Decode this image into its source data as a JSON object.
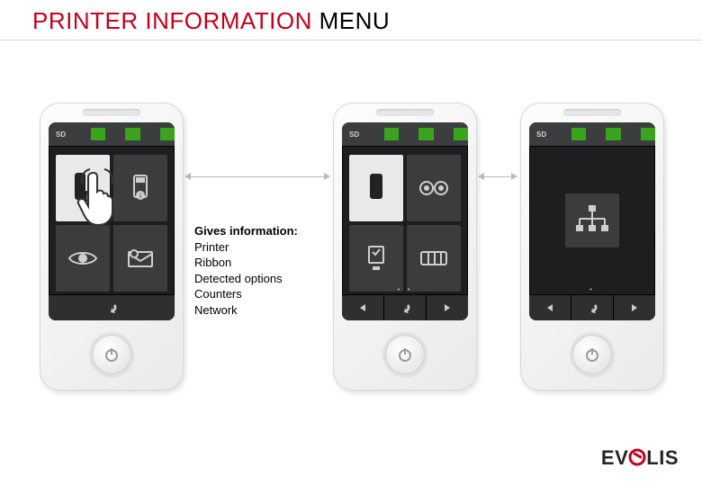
{
  "title": {
    "red": "PRINTER INFORMATION ",
    "black": "MENU"
  },
  "info": {
    "heading": "Gives information:",
    "items": [
      "Printer",
      "Ribbon",
      "Detected options",
      "Counters",
      "Network"
    ]
  },
  "statusbar_label": "SD",
  "devices": {
    "d1": {
      "tiles": [
        "printer-info-icon",
        "card-info-icon",
        "view-icon",
        "mail-icon"
      ],
      "selected_index": 0,
      "nav": [
        "back"
      ],
      "dots": ""
    },
    "d2": {
      "tiles": [
        "printer-icon",
        "ribbon-icon",
        "options-icon",
        "counters-icon"
      ],
      "selected_index": 0,
      "nav": [
        "prev",
        "back",
        "next"
      ],
      "dots": "• •"
    },
    "d3": {
      "single_tile": "network-icon",
      "nav": [
        "prev",
        "back",
        "next"
      ],
      "dots": "•"
    }
  },
  "brand": {
    "pre": "EV",
    "accent": "O",
    "post": "LIS"
  },
  "colors": {
    "brand_red": "#c5001c",
    "status_green": "#39a41c"
  }
}
